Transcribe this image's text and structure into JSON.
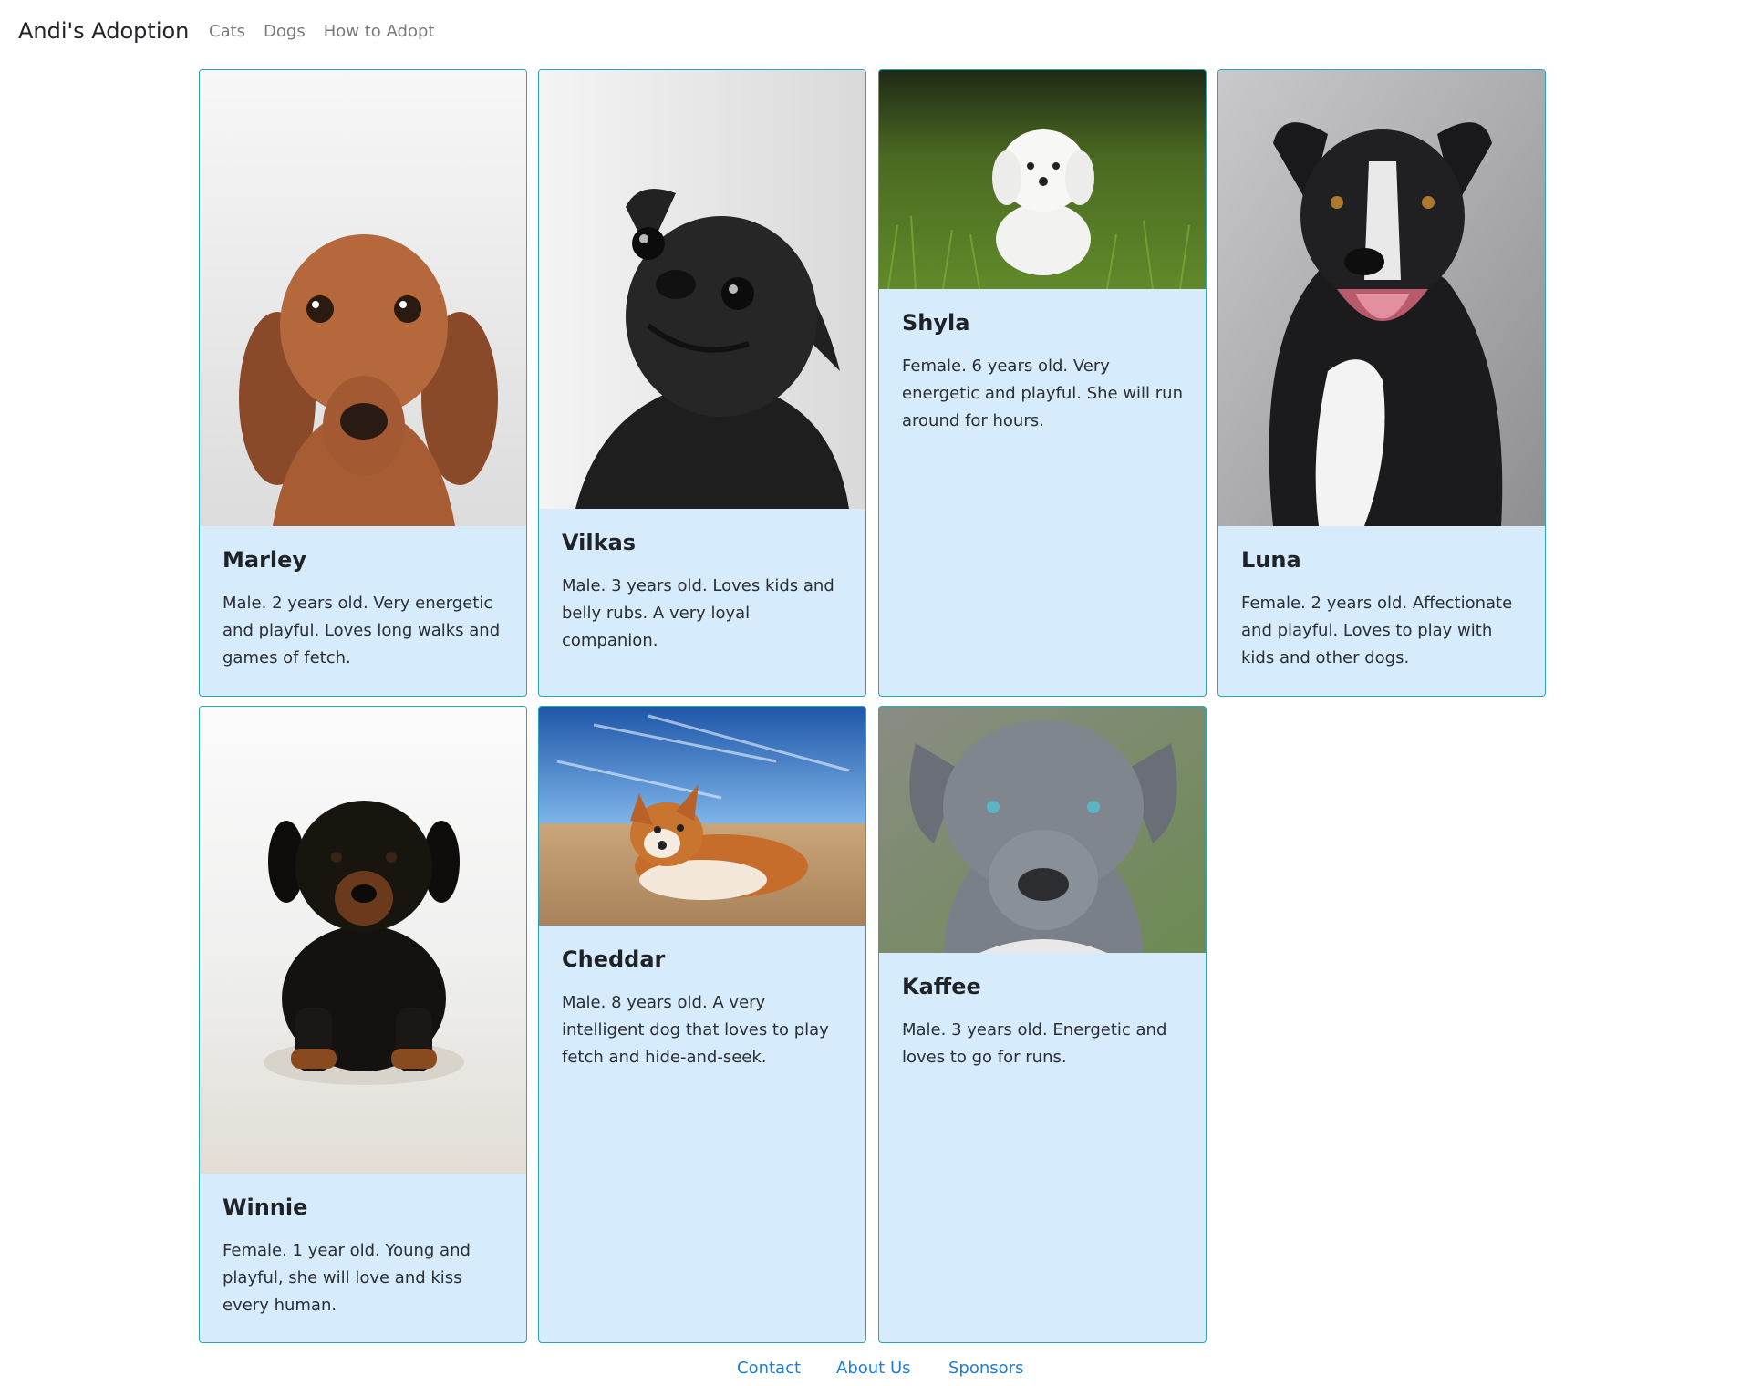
{
  "brand": "Andi's Adoption",
  "nav": {
    "cats": "Cats",
    "dogs": "Dogs",
    "how_to_adopt": "How to Adopt"
  },
  "cards": [
    {
      "name": "Marley",
      "description": "Male. 2 years old. Very energetic and playful. Loves long walks and games of fetch."
    },
    {
      "name": "Vilkas",
      "description": "Male. 3 years old. Loves kids and belly rubs. A very loyal companion."
    },
    {
      "name": "Shyla",
      "description": "Female. 6 years old. Very energetic and playful. She will run around for hours."
    },
    {
      "name": "Luna",
      "description": "Female. 2 years old. Affectionate and playful. Loves to play with kids and other dogs."
    },
    {
      "name": "Winnie",
      "description": "Female. 1 year old. Young and playful, she will love and kiss every human."
    },
    {
      "name": "Cheddar",
      "description": "Male. 8 years old. A very intelligent dog that loves to play fetch and hide-and-seek."
    },
    {
      "name": "Kaffee",
      "description": "Male. 3 years old. Energetic and loves to go for runs."
    }
  ],
  "footer": {
    "contact": "Contact",
    "about_us": "About Us",
    "sponsors": "Sponsors"
  },
  "colors": {
    "card_bg": "#d6ebfb",
    "card_border": "#2aa4ba",
    "link": "#1e7fd6"
  }
}
